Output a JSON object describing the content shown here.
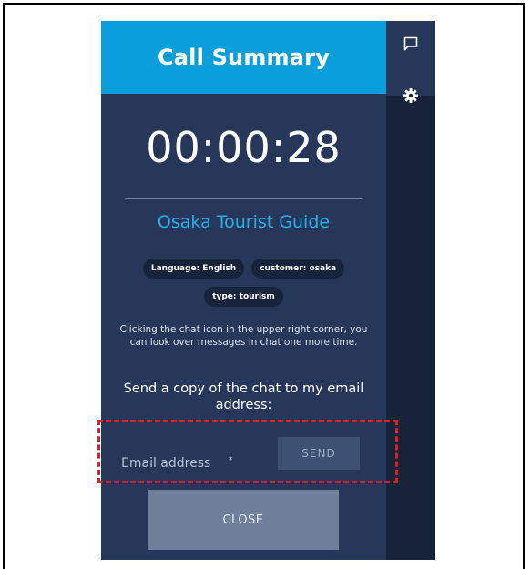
{
  "header": {
    "title": "Call Summary"
  },
  "summary": {
    "timer": "00:00:28",
    "guide_name": "Osaka Tourist Guide",
    "tags": [
      "Language: English",
      "customer: osaka",
      "type: tourism"
    ],
    "info_text": "Clicking the chat icon in the upper right corner, you can look over messages in chat one more time.",
    "send_copy_label": "Send a copy of the chat to my email address:"
  },
  "email": {
    "placeholder": "Email address",
    "required_marker": "*",
    "send_label": "SEND"
  },
  "close_label": "CLOSE",
  "sidebar": {
    "icons": [
      "chat-icon",
      "gear-icon"
    ]
  },
  "colors": {
    "header_bg": "#0b9edc",
    "panel_bg": "#26375a",
    "rail_bg": "#17233b",
    "accent_text": "#29aee8",
    "highlight": "#e0201e"
  }
}
